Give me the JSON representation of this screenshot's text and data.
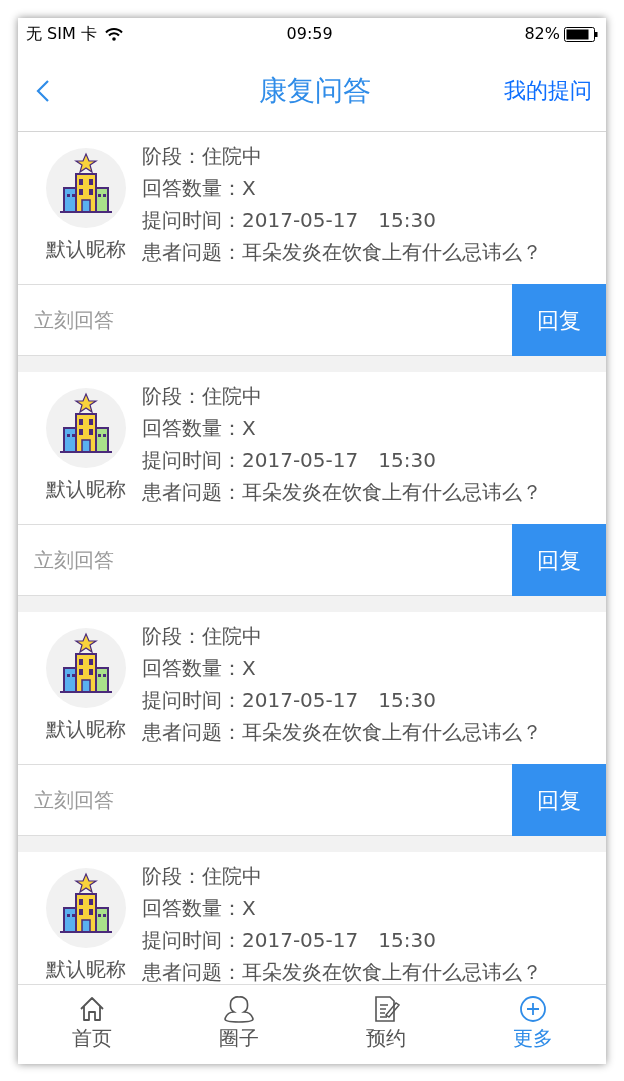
{
  "status_bar": {
    "carrier": "无 SIM 卡",
    "time": "09:59",
    "battery": "82%"
  },
  "header": {
    "title": "康复问答",
    "action": "我的提问"
  },
  "questions": [
    {
      "nickname": "默认昵称",
      "stage": "阶段：住院中",
      "answers": "回答数量：X",
      "time": "提问时间：2017-05-17　15:30",
      "question": "患者问题：耳朵发炎在饮食上有什么忌讳么？",
      "reply": {
        "placeholder": "立刻回答",
        "button": "回复"
      }
    },
    {
      "nickname": "默认昵称",
      "stage": "阶段：住院中",
      "answers": "回答数量：X",
      "time": "提问时间：2017-05-17　15:30",
      "question": "患者问题：耳朵发炎在饮食上有什么忌讳么？",
      "reply": {
        "placeholder": "立刻回答",
        "button": "回复"
      }
    },
    {
      "nickname": "默认昵称",
      "stage": "阶段：住院中",
      "answers": "回答数量：X",
      "time": "提问时间：2017-05-17　15:30",
      "question": "患者问题：耳朵发炎在饮食上有什么忌讳么？",
      "reply": {
        "placeholder": "立刻回答",
        "button": "回复"
      }
    },
    {
      "nickname": "默认昵称",
      "stage": "阶段：住院中",
      "answers": "回答数量：X",
      "time": "提问时间：2017-05-17　15:30",
      "question": "患者问题：耳朵发炎在饮食上有什么忌讳么？"
    }
  ],
  "tab_bar": [
    {
      "kind": "home",
      "label": "首页",
      "selected": false
    },
    {
      "kind": "people",
      "label": "圈子",
      "selected": false
    },
    {
      "kind": "document",
      "label": "预约",
      "selected": false
    },
    {
      "kind": "plus",
      "label": "更多",
      "selected": true
    }
  ]
}
